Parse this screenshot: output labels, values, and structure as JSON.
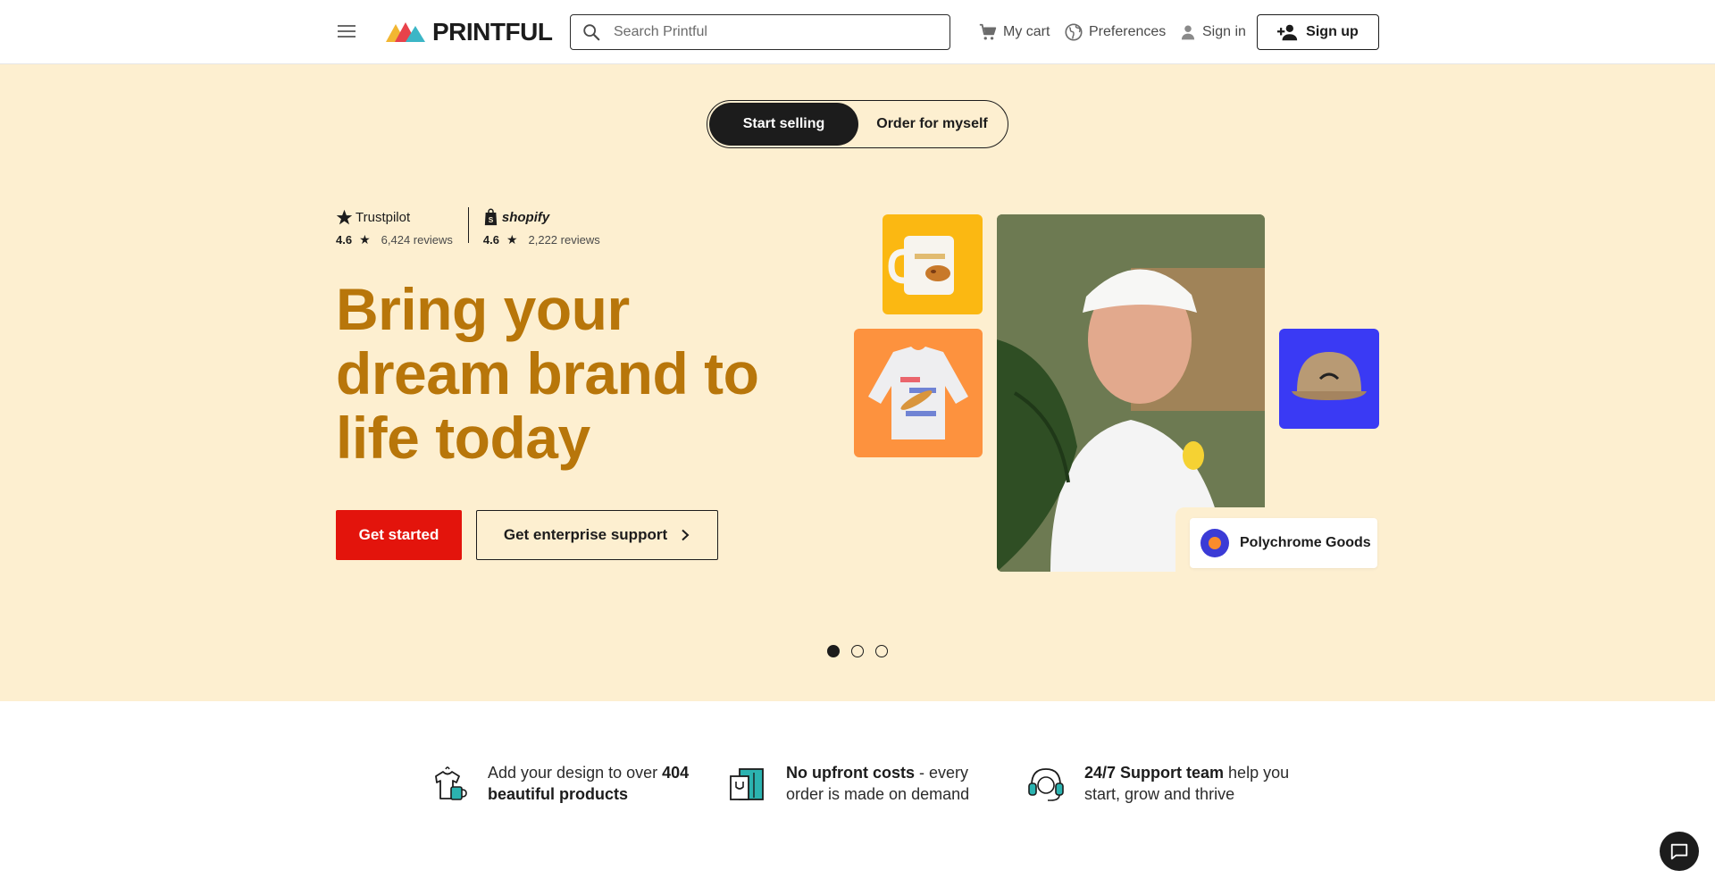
{
  "header": {
    "logo_text": "PRINTFUL",
    "search_placeholder": "Search Printful",
    "cart_label": "My cart",
    "preferences_label": "Preferences",
    "signin_label": "Sign in",
    "signup_label": "Sign up"
  },
  "hero": {
    "toggle": {
      "active_label": "Start selling",
      "inactive_label": "Order for myself"
    },
    "ratings": [
      {
        "brand": "Trustpilot",
        "score": "4.6",
        "reviews": "6,424 reviews"
      },
      {
        "brand": "shopify",
        "score": "4.6",
        "reviews": "2,222 reviews"
      }
    ],
    "headline": "Bring your dream brand to life today",
    "cta_primary": "Get started",
    "cta_secondary": "Get enterprise support",
    "brand_card": "Polychrome Goods",
    "carousel_count": 3,
    "carousel_active": 1
  },
  "features": [
    {
      "pre": "Add your design to over ",
      "bold": "404 beautiful products",
      "post": ""
    },
    {
      "pre": "",
      "bold": "No upfront costs",
      "post": " - every order is made on demand"
    },
    {
      "pre": "",
      "bold": "24/7 Support team",
      "post": " help you start, grow and thrive"
    }
  ],
  "colors": {
    "hero_bg": "#fdefd0",
    "headline": "#b8760a",
    "primary_cta": "#e3140c",
    "mug_tile": "#fbb812",
    "sweatshirt_tile": "#fd923e",
    "cap_tile": "#3a3af4"
  },
  "icons": {
    "menu": "hamburger-menu-icon",
    "search": "search-icon",
    "cart": "cart-icon",
    "preferences": "globe-icon",
    "signin": "user-icon",
    "signup": "add-user-icon",
    "chat": "chat-icon"
  }
}
